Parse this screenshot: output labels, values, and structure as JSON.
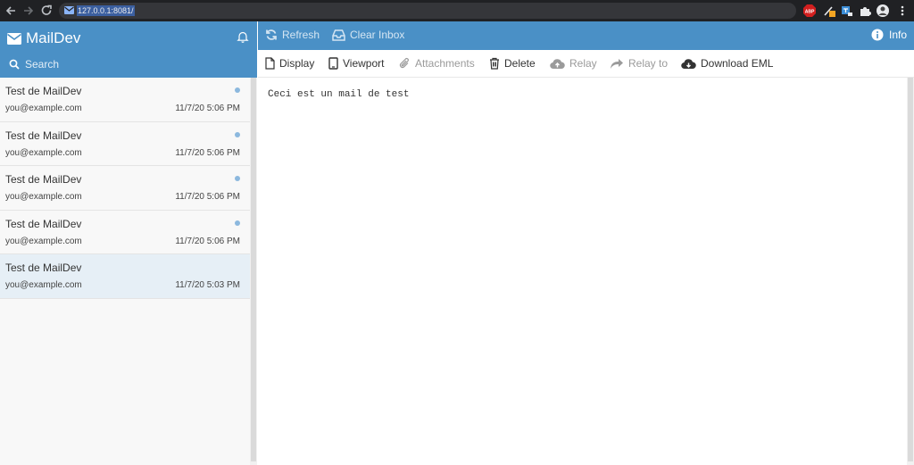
{
  "browser": {
    "url": "127.0.0.1:8081/",
    "extensions": [
      "adblock-icon",
      "pen-icon",
      "translate-icon",
      "puzzle-icon",
      "profile-avatar",
      "menu-dots-icon"
    ]
  },
  "app": {
    "name": "MailDev",
    "search_placeholder": "Search",
    "accent_color": "#4a90c6"
  },
  "messages": [
    {
      "subject": "Test de MailDev",
      "from": "you@example.com",
      "date": "11/7/20 5:06 PM",
      "unread": true
    },
    {
      "subject": "Test de MailDev",
      "from": "you@example.com",
      "date": "11/7/20 5:06 PM",
      "unread": true
    },
    {
      "subject": "Test de MailDev",
      "from": "you@example.com",
      "date": "11/7/20 5:06 PM",
      "unread": true
    },
    {
      "subject": "Test de MailDev",
      "from": "you@example.com",
      "date": "11/7/20 5:06 PM",
      "unread": true
    },
    {
      "subject": "Test de MailDev",
      "from": "you@example.com",
      "date": "11/7/20 5:03 PM",
      "unread": false,
      "selected": true
    }
  ],
  "topbar": {
    "refresh": "Refresh",
    "clear_inbox": "Clear Inbox",
    "info": "Info"
  },
  "toolbar": {
    "display": "Display",
    "viewport": "Viewport",
    "attachments": "Attachments",
    "delete": "Delete",
    "relay": "Relay",
    "relay_to": "Relay to",
    "download_eml": "Download EML"
  },
  "email": {
    "body": "Ceci est un mail de test"
  }
}
